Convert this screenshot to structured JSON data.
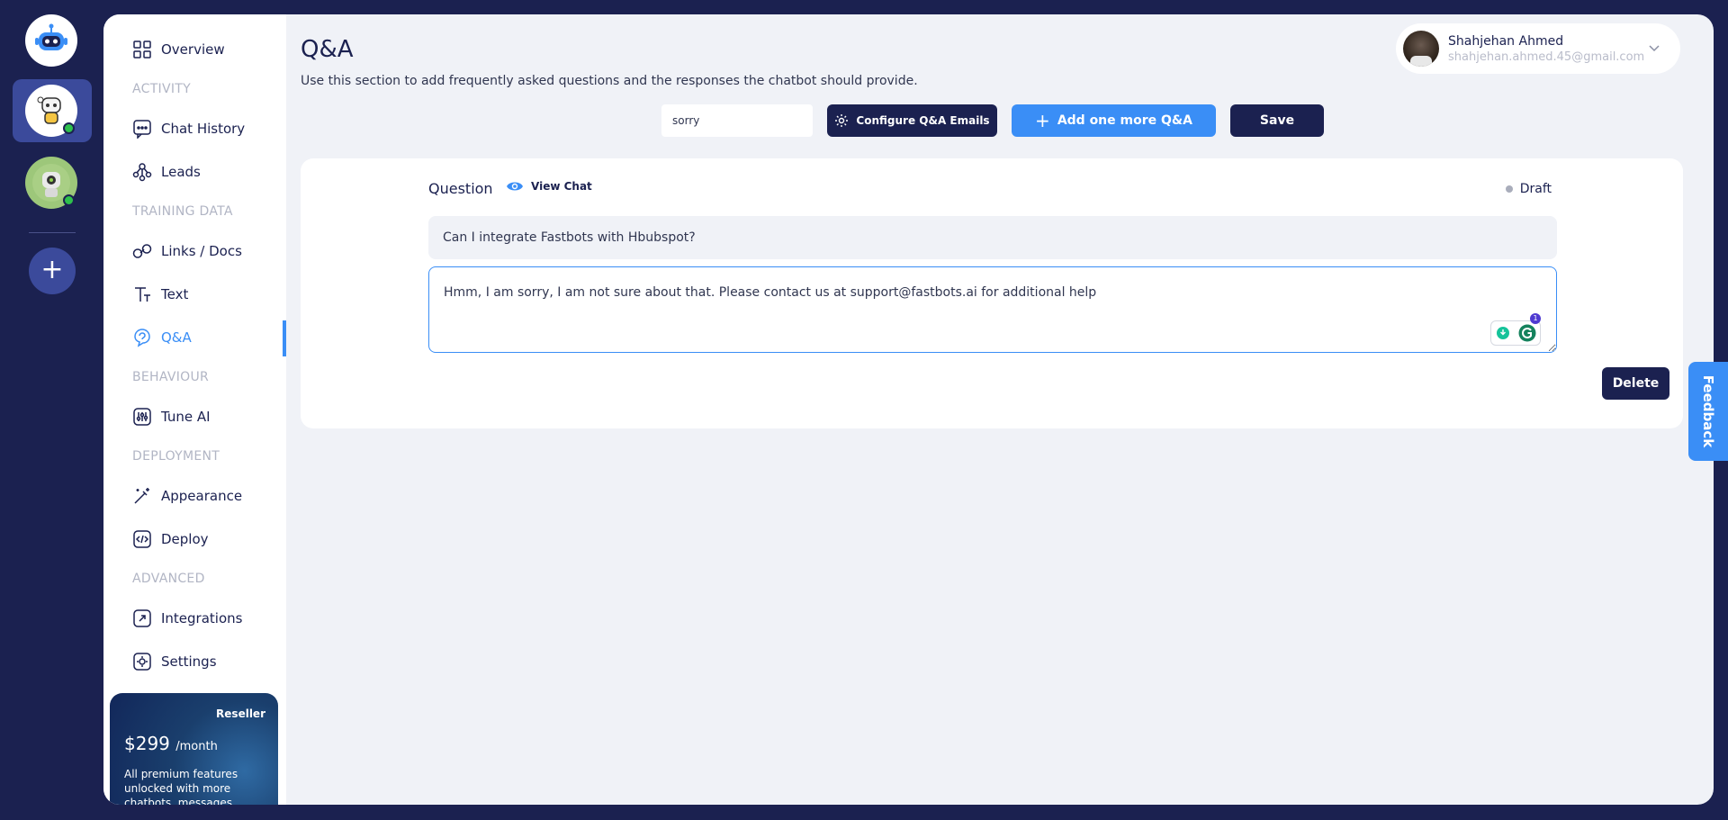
{
  "sidebar": {
    "items": [
      {
        "key": "overview",
        "label": "Overview"
      },
      {
        "key": "chat-history",
        "label": "Chat History"
      },
      {
        "key": "leads",
        "label": "Leads"
      },
      {
        "key": "links-docs",
        "label": "Links / Docs"
      },
      {
        "key": "text",
        "label": "Text"
      },
      {
        "key": "qa",
        "label": "Q&A"
      },
      {
        "key": "tune-ai",
        "label": "Tune AI"
      },
      {
        "key": "appearance",
        "label": "Appearance"
      },
      {
        "key": "deploy",
        "label": "Deploy"
      },
      {
        "key": "integrations",
        "label": "Integrations"
      },
      {
        "key": "settings",
        "label": "Settings"
      }
    ],
    "sections": {
      "activity": "ACTIVITY",
      "training": "TRAINING DATA",
      "behaviour": "BEHAVIOUR",
      "deployment": "DEPLOYMENT",
      "advanced": "ADVANCED"
    },
    "active": "qa",
    "promo": {
      "tag": "Reseller",
      "price": "$299",
      "period": "/month",
      "desc": "All premium features unlocked with more chatbots, messages, and"
    }
  },
  "header": {
    "title": "Q&A",
    "subtitle": "Use this section to add frequently asked questions and the responses the chatbot should provide."
  },
  "user": {
    "name": "Shahjehan Ahmed",
    "email": "shahjehan.ahmed.45@gmail.com"
  },
  "toolbar": {
    "search_value": "sorry",
    "configure_label": "Configure Q&A Emails",
    "add_label": "Add one more Q&A",
    "save_label": "Save"
  },
  "qa_card": {
    "question_label": "Question",
    "view_chat_label": "View Chat",
    "status": "Draft",
    "question": "Can I integrate Fastbots with Hbubspot?",
    "answer": "Hmm, I am sorry, I am not sure about that. Please contact us at support@fastbots.ai for additional help",
    "delete_label": "Delete",
    "grammarly_count": "1"
  },
  "feedback_label": "Feedback",
  "colors": {
    "navy": "#1b2150",
    "accent": "#3a8ef6",
    "status_online": "#2ec04c"
  }
}
